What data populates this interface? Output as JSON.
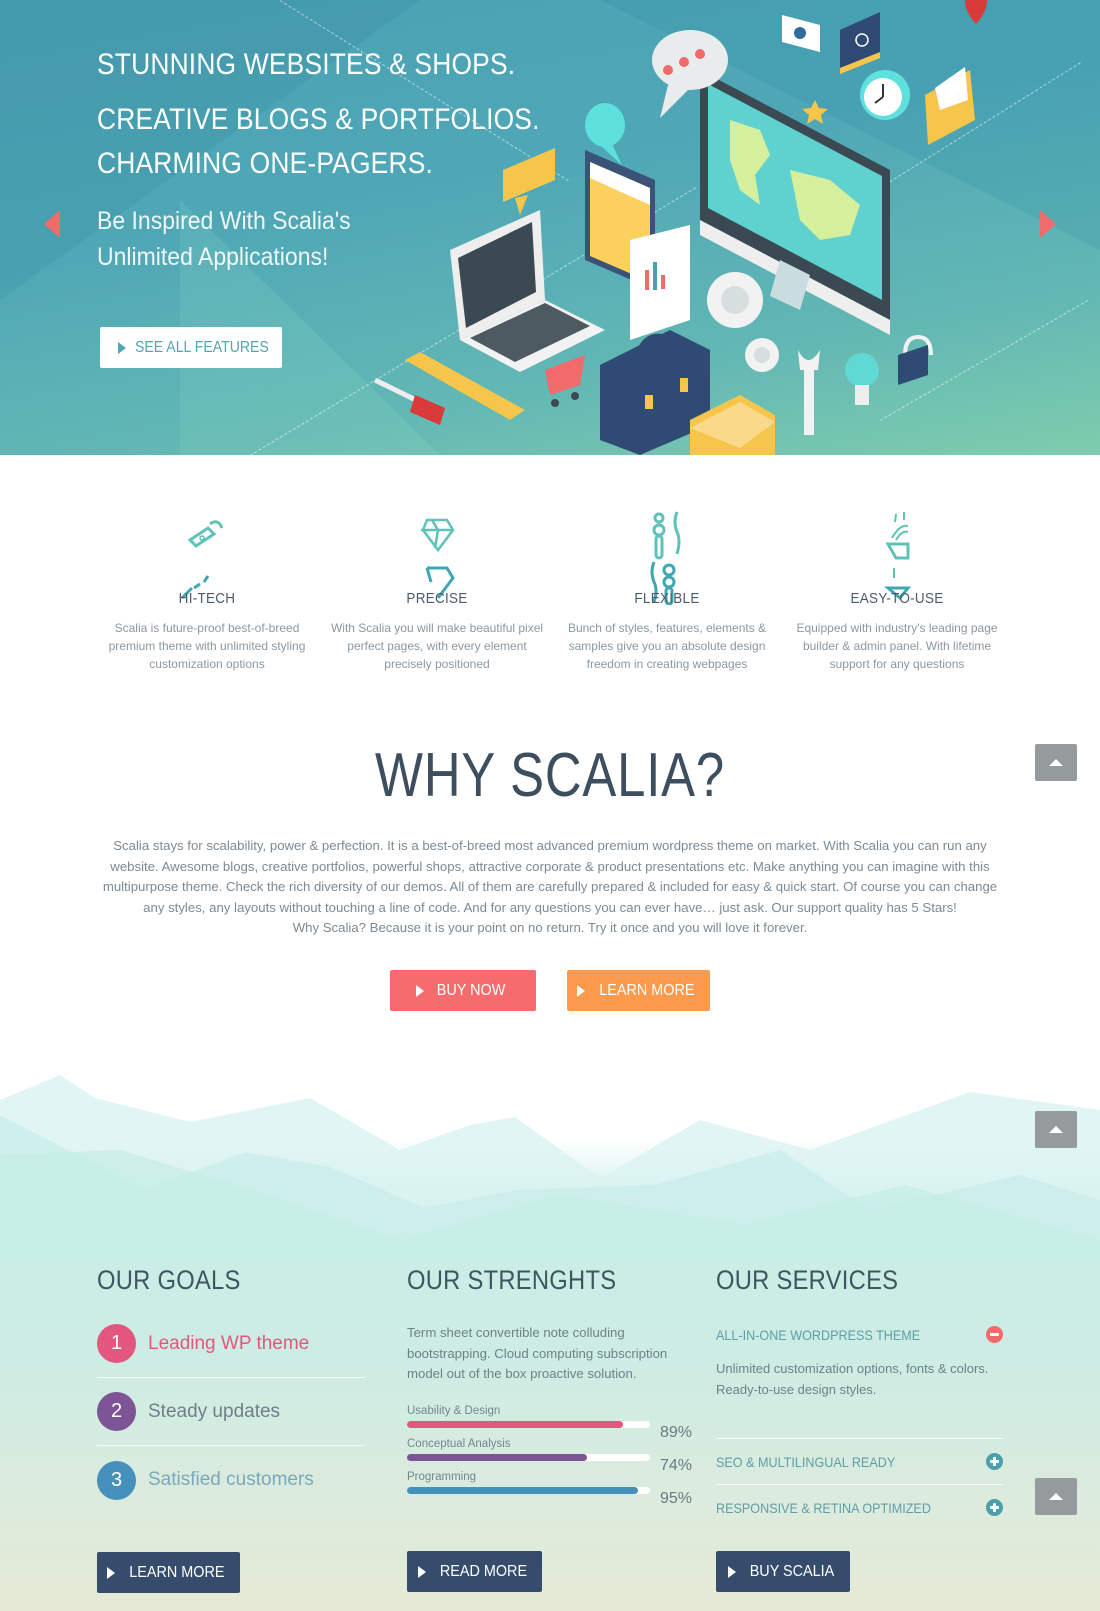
{
  "hero": {
    "headline_lines": [
      "STUNNING WEBSITES & SHOPS.",
      "CREATIVE BLOGS & PORTFOLIOS.",
      "CHARMING ONE-PAGERS."
    ],
    "subtitle_lines": [
      "Be Inspired With Scalia's",
      "Unlimited Applications!"
    ],
    "cta_label": "SEE ALL FEATURES",
    "prev_icon": "triangle-left-icon",
    "next_icon": "triangle-right-icon",
    "illustration": "isometric-web-devices-illustration"
  },
  "features": [
    {
      "title": "HI-TECH",
      "icon": "microscope-icon",
      "desc": "Scalia is future-proof best-of-breed premium theme with unlimited styling customization options"
    },
    {
      "title": "PRECISE",
      "icon": "diamond-icon",
      "desc": "With Scalia you will make beautiful pixel perfect pages, with every element precisely positioned"
    },
    {
      "title": "FLEXIBLE",
      "icon": "sliders-icon",
      "desc": "Bunch of styles, features, elements & samples give you an absolute design freedom in creating webpages"
    },
    {
      "title": "EASY-TO-USE",
      "icon": "coffee-cup-icon",
      "desc": "Equipped with industry's leading page builder & admin panel. With lifetime support for any questions"
    }
  ],
  "why": {
    "title": "WHY SCALIA?",
    "lines": [
      "Scalia stays for scalability, power & perfection. It is a best-of-breed most advanced premium wordpress theme on market. With Scalia you can run any",
      "website. Awesome blogs, creative portfolios, powerful shops, attractive corporate & product presentations etc. Make anything you can imagine with this",
      "multipurpose theme. Check the rich diversity of our demos. All of them are carefully prepared & included for easy & quick start. Of course you can change",
      "any styles, any layouts without touching a line of code.  And for any questions you can ever have… just ask. Our support quality has 5 Stars!",
      "Why Scalia? Because it is your point on no return. Try it once and you will love it forever."
    ],
    "buy_label": "BUY NOW",
    "learn_label": "LEARN MORE"
  },
  "goals": {
    "title": "OUR GOALS",
    "items": [
      {
        "num": "1",
        "label": "Leading WP theme",
        "color": "#e3577f"
      },
      {
        "num": "2",
        "label": "Steady updates",
        "color": "#7d5495"
      },
      {
        "num": "3",
        "label": "Satisfied customers",
        "color": "#4691bc"
      }
    ],
    "button_label": "LEARN MORE"
  },
  "strengths": {
    "title": "OUR STRENGHTS",
    "desc": "Term sheet convertible note colluding bootstrapping. Cloud computing subscription model out of the box proactive solution.",
    "skills": [
      {
        "name": "Usability & Design",
        "value": 89,
        "label": "89%",
        "color": "#e3577f"
      },
      {
        "name": "Conceptual Analysis",
        "value": 74,
        "label": "74%",
        "color": "#7d5495"
      },
      {
        "name": "Programming",
        "value": 95,
        "label": "95%",
        "color": "#4691bc"
      }
    ],
    "button_label": "READ MORE"
  },
  "services": {
    "title": "OUR SERVICES",
    "items": [
      {
        "label": "ALL-IN-ONE WORDPRESS THEME",
        "expanded": true,
        "icon": "minus-circle-icon",
        "desc_lines": [
          "Unlimited customization options, fonts & colors.",
          "Ready-to-use design styles."
        ]
      },
      {
        "label": "SEO & MULTILINGUAL READY",
        "expanded": false,
        "icon": "plus-circle-icon"
      },
      {
        "label": "RESPONSIVE & RETINA OPTIMIZED",
        "expanded": false,
        "icon": "plus-circle-icon"
      }
    ],
    "button_label": "BUY SCALIA"
  },
  "colors": {
    "accent_red": "#f66b6e",
    "accent_orange": "#fb9a4c",
    "dark_button": "#364c6c",
    "teal": "#5d9ea8",
    "minus_toggle": "#f26b6b",
    "plus_toggle": "#4aa0ab"
  },
  "scroll_top_icon": "arrow-up-icon"
}
